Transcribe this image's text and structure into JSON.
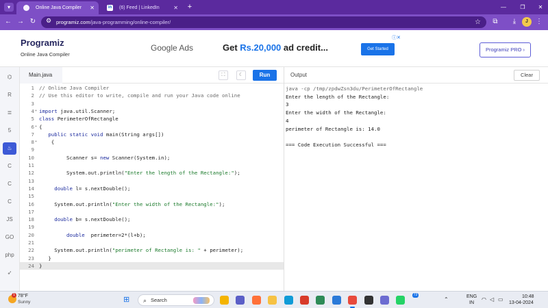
{
  "browser": {
    "tabs": [
      {
        "label": "Online Java Compiler",
        "active": true
      },
      {
        "label": "(6) Feed | LinkedIn",
        "active": false
      }
    ],
    "new_tab": "+",
    "url_host": "programiz.com",
    "url_path": "/java-programming/online-compiler/",
    "profile_initial": "J"
  },
  "site": {
    "logo": "Programiz",
    "tagline": "Online Java Compiler",
    "ad": {
      "brand": "Google Ads",
      "headline_pre": "Get ",
      "headline_amount": "Rs.20,000",
      "headline_post": " ad credit...",
      "cta": "Get Started"
    },
    "pro_button": "Programiz PRO ›"
  },
  "editor": {
    "file_name": "Main.java",
    "run_label": "Run",
    "lines": [
      {
        "n": "1",
        "fold": "",
        "parts": [
          [
            "cm",
            "// Online Java Compiler"
          ]
        ]
      },
      {
        "n": "2",
        "fold": "",
        "parts": [
          [
            "cm",
            "// Use this editor to write, compile and run your Java code online"
          ]
        ]
      },
      {
        "n": "3",
        "fold": "",
        "parts": []
      },
      {
        "n": "4",
        "fold": "▾",
        "parts": [
          [
            "kw",
            "import"
          ],
          [
            "",
            " java.util.Scanner;"
          ]
        ]
      },
      {
        "n": "5",
        "fold": "",
        "parts": [
          [
            "kw",
            "class"
          ],
          [
            "",
            " PerimeterOfRectangle"
          ]
        ]
      },
      {
        "n": "6",
        "fold": "▾",
        "parts": [
          [
            "",
            "{"
          ]
        ]
      },
      {
        "n": "7",
        "fold": "",
        "parts": [
          [
            "",
            "   "
          ],
          [
            "kw",
            "public static void"
          ],
          [
            "",
            " main(String args[])"
          ]
        ]
      },
      {
        "n": "8",
        "fold": "▾",
        "parts": [
          [
            "",
            "    {"
          ]
        ]
      },
      {
        "n": "9",
        "fold": "",
        "parts": []
      },
      {
        "n": "10",
        "fold": "",
        "parts": [
          [
            "",
            "         Scanner s= "
          ],
          [
            "kw",
            "new"
          ],
          [
            "",
            " Scanner(System.in);"
          ]
        ]
      },
      {
        "n": "11",
        "fold": "",
        "parts": []
      },
      {
        "n": "12",
        "fold": "",
        "parts": [
          [
            "",
            "         System.out.println("
          ],
          [
            "st",
            "\"Enter the length of the Rectangle:\""
          ],
          [
            "",
            ");"
          ]
        ]
      },
      {
        "n": "13",
        "fold": "",
        "parts": []
      },
      {
        "n": "14",
        "fold": "",
        "parts": [
          [
            "",
            "     "
          ],
          [
            "kw",
            "double"
          ],
          [
            "",
            " l= s.nextDouble();"
          ]
        ]
      },
      {
        "n": "15",
        "fold": "",
        "parts": []
      },
      {
        "n": "16",
        "fold": "",
        "parts": [
          [
            "",
            "     System.out.println("
          ],
          [
            "st",
            "\"Enter the width of the Rectangle:\""
          ],
          [
            "",
            ");"
          ]
        ]
      },
      {
        "n": "17",
        "fold": "",
        "parts": []
      },
      {
        "n": "18",
        "fold": "",
        "parts": [
          [
            "",
            "     "
          ],
          [
            "kw",
            "double"
          ],
          [
            "",
            " b= s.nextDouble();"
          ]
        ]
      },
      {
        "n": "19",
        "fold": "",
        "parts": []
      },
      {
        "n": "20",
        "fold": "",
        "parts": [
          [
            "",
            "         "
          ],
          [
            "kw",
            "double"
          ],
          [
            "",
            "  perimeter=2*(l+b);"
          ]
        ]
      },
      {
        "n": "21",
        "fold": "",
        "parts": []
      },
      {
        "n": "22",
        "fold": "",
        "parts": [
          [
            "",
            "     System.out.println("
          ],
          [
            "st",
            "\"perimeter of Rectangle is: \""
          ],
          [
            "",
            " + perimeter);"
          ]
        ]
      },
      {
        "n": "23",
        "fold": "",
        "parts": [
          [
            "",
            "   }"
          ]
        ]
      },
      {
        "n": "24",
        "fold": "",
        "parts": [
          [
            "",
            "}"
          ]
        ]
      }
    ],
    "current_line": 24
  },
  "output": {
    "title": "Output",
    "clear_label": "Clear",
    "lines": [
      {
        "text": "java -cp /tmp/zpdwZsn3du/PerimeterOfRectangle",
        "kind": "cmd"
      },
      {
        "text": "Enter the length of the Rectangle:",
        "kind": ""
      },
      {
        "text": "3",
        "kind": ""
      },
      {
        "text": "Enter the width of the Rectangle:",
        "kind": ""
      },
      {
        "text": "4",
        "kind": ""
      },
      {
        "text": "perimeter of Rectangle is: 14.0",
        "kind": ""
      },
      {
        "text": "",
        "kind": ""
      },
      {
        "text": "=== Code Execution Successful ===",
        "kind": ""
      }
    ]
  },
  "sidebar": {
    "languages": [
      {
        "name": "python-icon",
        "glyph": "⌬"
      },
      {
        "name": "r-icon",
        "glyph": "R"
      },
      {
        "name": "sql-icon",
        "glyph": "≣"
      },
      {
        "name": "html-icon",
        "glyph": "5"
      },
      {
        "name": "java-icon",
        "glyph": "♨",
        "active": true
      },
      {
        "name": "c-icon",
        "glyph": "C"
      },
      {
        "name": "cpp-icon",
        "glyph": "C"
      },
      {
        "name": "csharp-icon",
        "glyph": "C"
      },
      {
        "name": "javascript-icon",
        "glyph": "JS"
      },
      {
        "name": "go-icon",
        "glyph": "GO"
      },
      {
        "name": "php-icon",
        "glyph": "php"
      },
      {
        "name": "swift-icon",
        "glyph": "➶"
      }
    ]
  },
  "taskbar": {
    "weather_temp": "78°F",
    "weather_cond": "Sunny",
    "weather_badge": "1",
    "search_label": "Search",
    "whatsapp_badge": "73",
    "lang_top": "ENG",
    "lang_bottom": "IN",
    "time": "10:48",
    "date": "13-04-2024",
    "apps": [
      {
        "name": "file-explorer-icon",
        "color": "#f4b400"
      },
      {
        "name": "teams-icon",
        "color": "#5b5fc7"
      },
      {
        "name": "firefox-icon",
        "color": "#ff7139"
      },
      {
        "name": "folder-icon",
        "color": "#f6c244"
      },
      {
        "name": "edge-icon",
        "color": "#0f9bd7"
      },
      {
        "name": "wps-icon",
        "color": "#d83b2a"
      },
      {
        "name": "store-icon",
        "color": "#2e8b57"
      },
      {
        "name": "vscode-icon",
        "color": "#2b7ad8"
      },
      {
        "name": "chrome-icon",
        "color": "#e84a3c",
        "active": true
      },
      {
        "name": "terminal-icon",
        "color": "#333333"
      },
      {
        "name": "app-icon",
        "color": "#6c6cd1"
      },
      {
        "name": "whatsapp-icon",
        "color": "#25d366"
      }
    ]
  },
  "colors": {
    "browser_frame": "#5b2a9e",
    "accent": "#1a73e8",
    "editor_bg": "#ffffff"
  }
}
